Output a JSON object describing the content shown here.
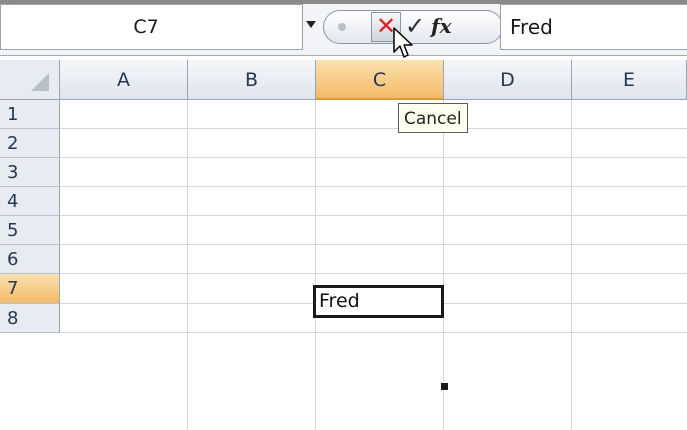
{
  "formula_bar": {
    "name_box_value": "C7",
    "cancel_icon": "x-icon",
    "enter_icon": "checkmark-icon",
    "function_label": "fx",
    "formula_value": "Fred"
  },
  "columns": [
    "A",
    "B",
    "C",
    "D",
    "E"
  ],
  "rows": [
    "1",
    "2",
    "3",
    "4",
    "5",
    "6",
    "7",
    "8"
  ],
  "active_cell": {
    "ref": "C7",
    "value": "Fred"
  },
  "tooltip": "Cancel",
  "colors": {
    "cancel_x": "#e0202a",
    "active_header": "#f4bb68",
    "tooltip_bg": "#fffff0"
  }
}
